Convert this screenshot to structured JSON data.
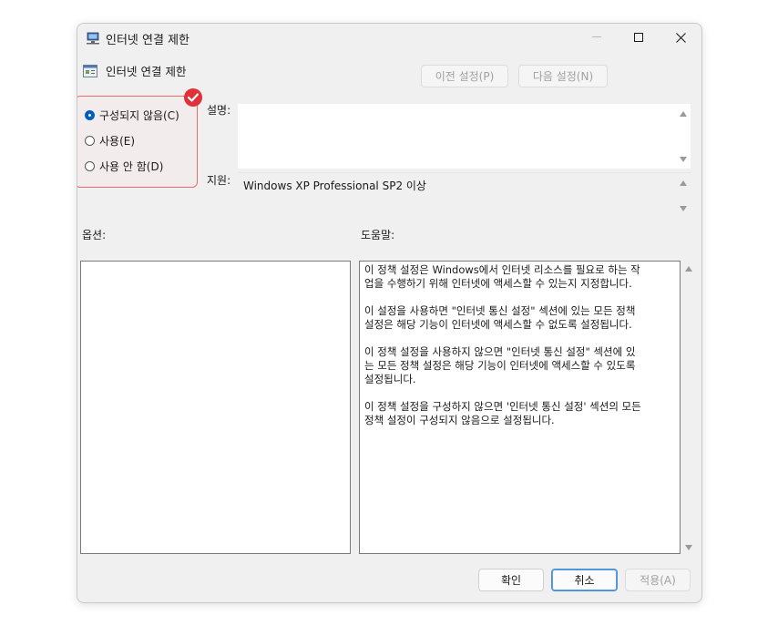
{
  "window": {
    "title": "인터넷 연결 제한"
  },
  "header": {
    "title": "인터넷 연결 제한"
  },
  "nav": {
    "prev_label": "이전 설정(P)",
    "next_label": "다음 설정(N)"
  },
  "radios": [
    {
      "label": "구성되지 않음(C)",
      "checked": true
    },
    {
      "label": "사용(E)",
      "checked": false
    },
    {
      "label": "사용 안 함(D)",
      "checked": false
    }
  ],
  "labels": {
    "description": "설명:",
    "supported_on": "지원:",
    "options": "옵션:",
    "help": "도움말:"
  },
  "supported_on_value": "Windows XP Professional SP2 이상",
  "help_paragraphs": [
    "이 정책 설정은 Windows에서 인터넷 리소스를 필요로 하는 작\n업을 수행하기 위해 인터넷에 액세스할 수 있는지 지정합니다.",
    "이 설정을 사용하면 \"인터넷 통신 설정\" 섹션에 있는 모든 정책\n설정은 해당 기능이 인터넷에 액세스할 수 없도록 설정됩니다.",
    "이 정책 설정을 사용하지 않으면 \"인터넷 통신 설정\" 섹션에 있\n는 모든 정책 설정은 해당 기능이 인터넷에 액세스할 수 있도록\n설정됩니다.",
    "이 정책 설정을 구성하지 않으면 '인터넷 통신 설정' 섹션의 모든\n정책 설정이 구성되지 않음으로 설정됩니다."
  ],
  "buttons": {
    "ok": "확인",
    "cancel": "취소",
    "apply": "적용(A)"
  },
  "colors": {
    "accent": "#005fb8",
    "highlight_border": "#e86a6a",
    "badge": "#e0303a"
  }
}
